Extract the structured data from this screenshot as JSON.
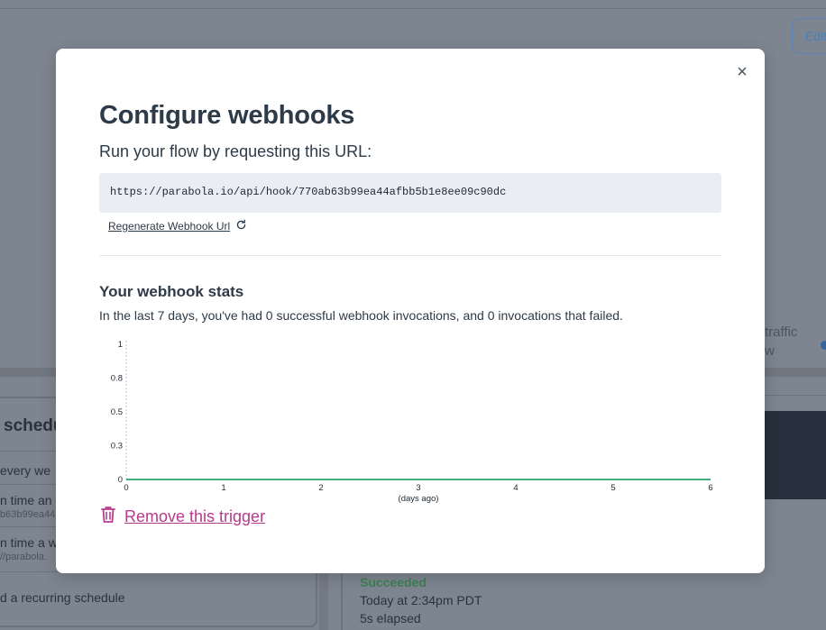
{
  "background": {
    "edit_button_label": "Edit",
    "traffic_line1": "traffic",
    "traffic_line2": "w",
    "schedule_title": "schedu",
    "items": [
      {
        "label": "every we",
        "sub": ""
      },
      {
        "label": "n time an",
        "sub": "b63b99ea44"
      },
      {
        "label": "n time a w",
        "sub": "//parabola."
      },
      {
        "label": "d a recurring schedule",
        "sub": ""
      }
    ],
    "run_status": "Succeeded",
    "run_time": "Today at 2:34pm PDT",
    "run_elapsed": "5s elapsed"
  },
  "modal": {
    "close_glyph": "×",
    "title": "Configure webhooks",
    "subtitle": "Run your flow by requesting this URL:",
    "webhook_url": "https://parabola.io/api/hook/770ab63b99ea44afbb5b1e8ee09c90dc",
    "regenerate_label": "Regenerate Webhook Url",
    "regenerate_icon": "refresh-icon",
    "stats_title": "Your webhook stats",
    "stats_description": "In the last 7 days, you've had 0 successful webhook invocations, and 0 invocations that failed.",
    "remove_label": "Remove this trigger",
    "remove_icon": "trash-icon"
  },
  "colors": {
    "accent_link": "#b63a8d",
    "series_line": "#3fae7a",
    "url_bg": "#eaedf4"
  },
  "chart_data": {
    "type": "line",
    "x": [
      0,
      1,
      2,
      3,
      4,
      5,
      6
    ],
    "xticks": [
      "0",
      "1",
      "2",
      "3",
      "4",
      "5",
      "6"
    ],
    "yticks": [
      "0",
      "0.3",
      "0.5",
      "0.8",
      "1"
    ],
    "ytick_values": [
      0,
      0.25,
      0.5,
      0.75,
      1
    ],
    "series": [
      {
        "values": [
          0,
          0,
          0,
          0,
          0,
          0,
          0
        ],
        "color": "#3fae7a"
      }
    ],
    "xlabel": "(days ago)",
    "ylabel": "",
    "xlim": [
      0,
      6
    ],
    "ylim": [
      0,
      1
    ],
    "grid": false
  }
}
